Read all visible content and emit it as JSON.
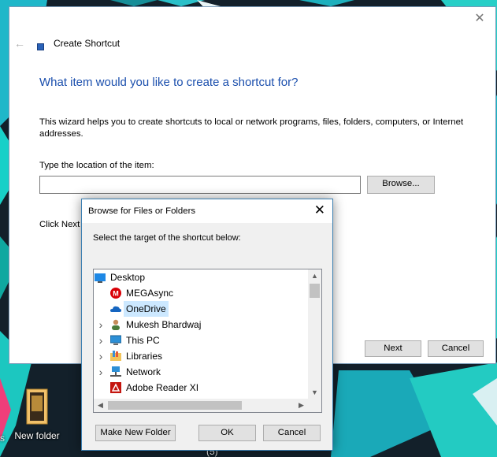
{
  "desktop": {
    "folder_label": "New folder",
    "taskbar_hint": "(5)",
    "edge_label": "s"
  },
  "wizard": {
    "window_title": "Create Shortcut",
    "heading": "What item would you like to create a shortcut for?",
    "description": "This wizard helps you to create shortcuts to local or network programs, files, folders, computers, or Internet addresses.",
    "location_label": "Type the location of the item:",
    "location_value": "",
    "browse_label": "Browse...",
    "click_next_text": "Click Next",
    "next_label": "Next",
    "cancel_label": "Cancel"
  },
  "browse_dialog": {
    "title": "Browse for Files or Folders",
    "prompt": "Select the target of the shortcut below:",
    "tree": [
      {
        "label": "Desktop",
        "icon": "desktop-icon",
        "level": 0,
        "expandable": false,
        "selected": false
      },
      {
        "label": "MEGAsync",
        "icon": "megasync-icon",
        "level": 1,
        "expandable": false,
        "selected": false
      },
      {
        "label": "OneDrive",
        "icon": "onedrive-icon",
        "level": 1,
        "expandable": false,
        "selected": true
      },
      {
        "label": "Mukesh Bhardwaj",
        "icon": "user-icon",
        "level": 1,
        "expandable": true,
        "selected": false
      },
      {
        "label": "This PC",
        "icon": "computer-icon",
        "level": 1,
        "expandable": true,
        "selected": false
      },
      {
        "label": "Libraries",
        "icon": "libraries-icon",
        "level": 1,
        "expandable": true,
        "selected": false
      },
      {
        "label": "Network",
        "icon": "network-icon",
        "level": 1,
        "expandable": true,
        "selected": false
      },
      {
        "label": "Adobe Reader XI",
        "icon": "adobe-reader-icon",
        "level": 1,
        "expandable": false,
        "selected": false
      }
    ],
    "new_folder_label": "Make New Folder",
    "ok_label": "OK",
    "cancel_label": "Cancel"
  },
  "colors": {
    "heading_blue": "#1b4fad",
    "selection": "#cce8ff",
    "dialog_border": "#3c7fb1"
  }
}
